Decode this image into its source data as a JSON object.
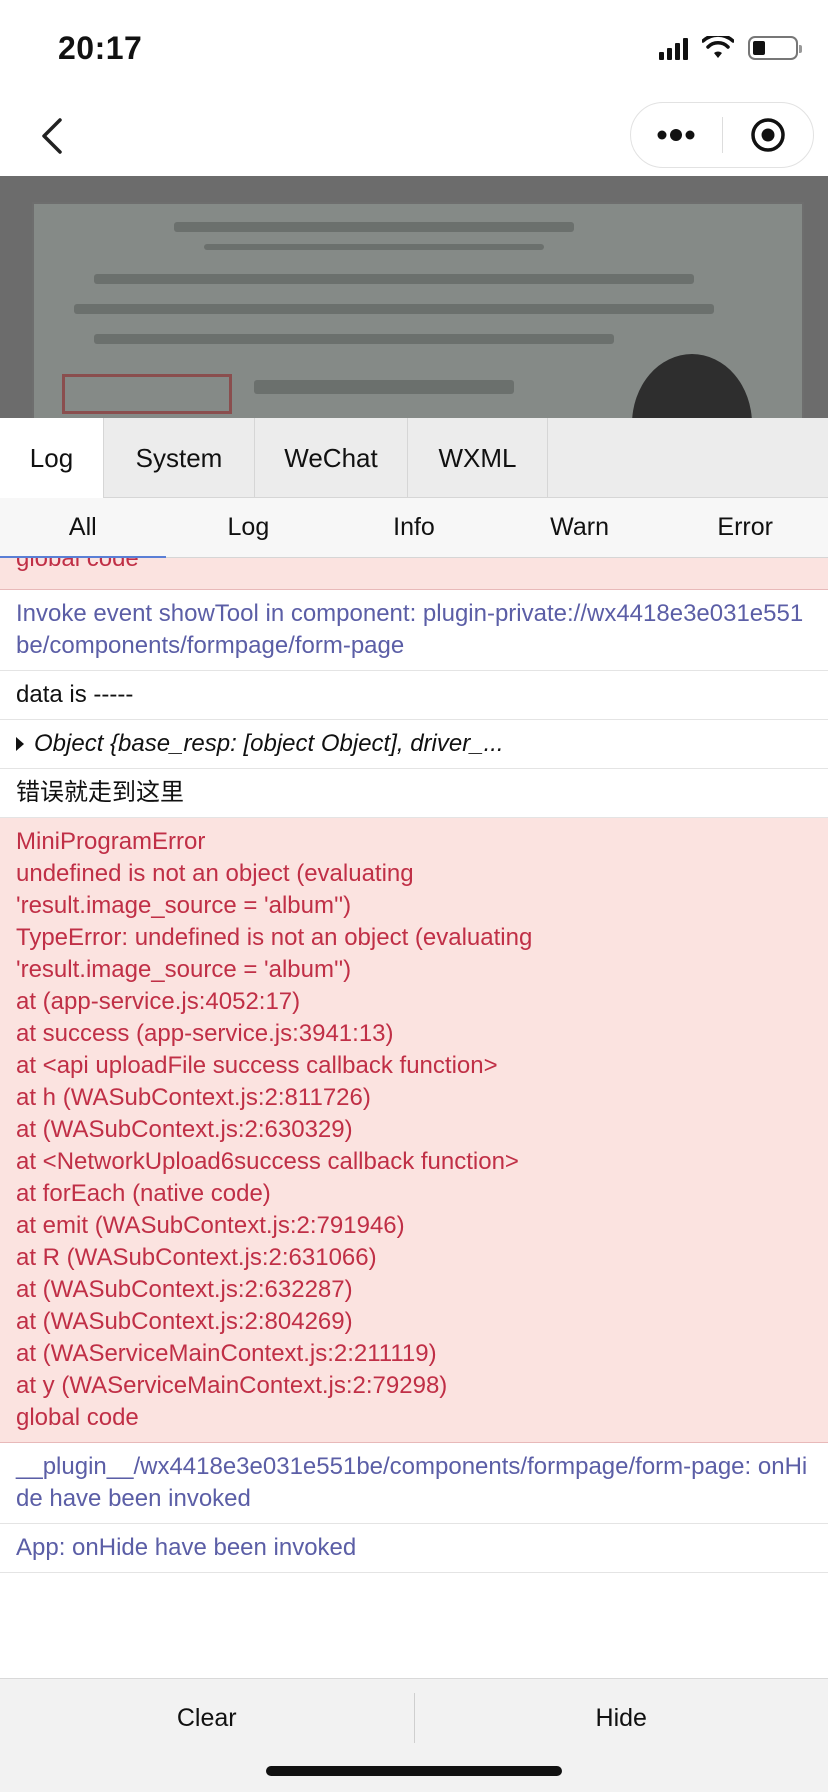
{
  "status_bar": {
    "time": "20:17"
  },
  "tabs": [
    {
      "label": "Log",
      "active": true
    },
    {
      "label": "System",
      "active": false
    },
    {
      "label": "WeChat",
      "active": false
    },
    {
      "label": "WXML",
      "active": false
    }
  ],
  "filters": [
    {
      "label": "All",
      "active": true
    },
    {
      "label": "Log",
      "active": false
    },
    {
      "label": "Info",
      "active": false
    },
    {
      "label": "Warn",
      "active": false
    },
    {
      "label": "Error",
      "active": false
    }
  ],
  "logs": {
    "partial_top": "global code",
    "invoke_event": "Invoke event showTool in component: plugin-private://wx4418e3e031e551be/components/formpage/form-page",
    "data_is": "data is -----",
    "object_preview": "Object {base_resp: [object Object], driver_...",
    "chinese_msg": "错误就走到这里",
    "error_lines": [
      "MiniProgramError",
      "undefined is not an object (evaluating",
      "'result.image_source = 'album'')",
      "TypeError: undefined is not an object (evaluating",
      "'result.image_source = 'album'')",
      "at (app-service.js:4052:17)",
      "at success (app-service.js:3941:13)",
      "at <api uploadFile success callback function>",
      "at h (WASubContext.js:2:811726)",
      "at (WASubContext.js:2:630329)",
      "at <NetworkUpload6success callback function>",
      "at forEach (native code)",
      "at emit (WASubContext.js:2:791946)",
      "at R (WASubContext.js:2:631066)",
      "at (WASubContext.js:2:632287)",
      "at (WASubContext.js:2:804269)",
      "at (WAServiceMainContext.js:2:211119)",
      "at y (WAServiceMainContext.js:2:79298)",
      "global code"
    ],
    "plugin_hide": "__plugin__/wx4418e3e031e551be/components/formpage/form-page: onHide have been invoked",
    "app_hide": "App: onHide have been invoked"
  },
  "bottom": {
    "clear_label": "Clear",
    "hide_label": "Hide"
  },
  "colors": {
    "error_bg": "#fbe3e0",
    "error_text": "#c02f46",
    "info_text": "#5b5ea6"
  }
}
